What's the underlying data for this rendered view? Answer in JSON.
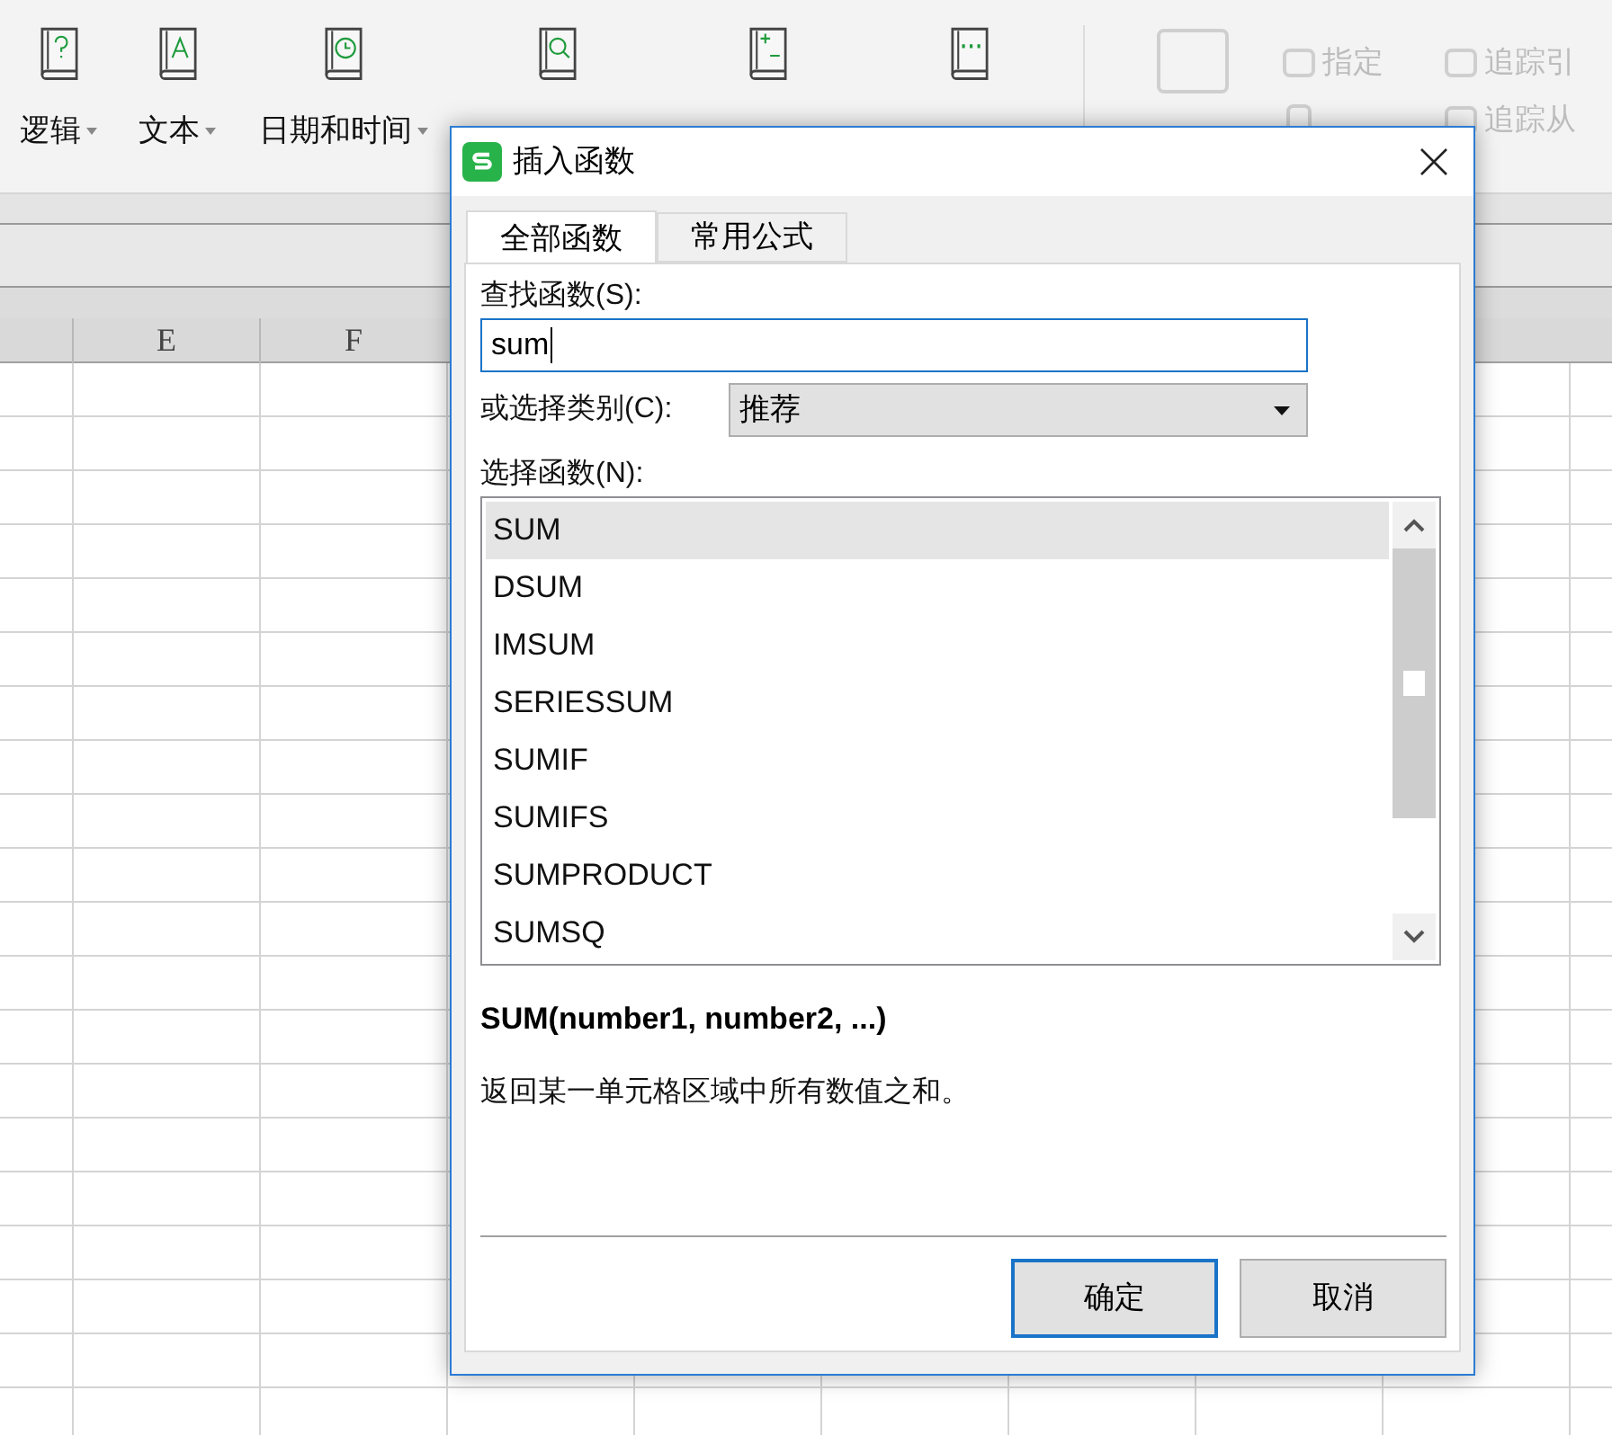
{
  "ribbon": {
    "groups": [
      {
        "label": "逻辑"
      },
      {
        "label": "文本"
      },
      {
        "label": "日期和时间"
      }
    ],
    "disabled_tools": [
      {
        "label": "指定"
      },
      {
        "label": "追踪引"
      },
      {
        "label": "追踪从"
      }
    ]
  },
  "sheet": {
    "columns": [
      "E",
      "F"
    ]
  },
  "dialog": {
    "title": "插入函数",
    "tabs": [
      {
        "label": "全部函数",
        "selected": true
      },
      {
        "label": "常用公式",
        "selected": false
      }
    ],
    "search_label": "查找函数(S):",
    "search_value": "sum",
    "category_label": "或选择类别(C):",
    "category_value": "推荐",
    "list_label": "选择函数(N):",
    "functions": [
      {
        "name": "SUM",
        "selected": true
      },
      {
        "name": "DSUM",
        "selected": false
      },
      {
        "name": "IMSUM",
        "selected": false
      },
      {
        "name": "SERIESSUM",
        "selected": false
      },
      {
        "name": "SUMIF",
        "selected": false
      },
      {
        "name": "SUMIFS",
        "selected": false
      },
      {
        "name": "SUMPRODUCT",
        "selected": false
      },
      {
        "name": "SUMSQ",
        "selected": false
      }
    ],
    "signature": "SUM(number1, number2, ...)",
    "description": "返回某一单元格区域中所有数值之和。",
    "buttons": [
      {
        "label": "确定",
        "default": true
      },
      {
        "label": "取消",
        "default": false
      }
    ]
  }
}
